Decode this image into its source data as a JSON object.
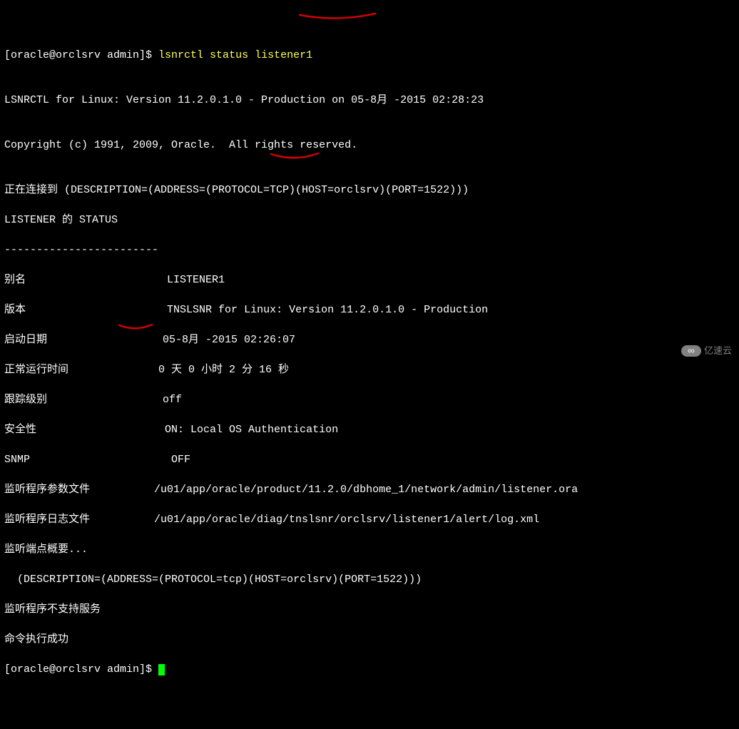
{
  "prompt1_prefix": "[oracle@orclsrv admin]$ ",
  "prompt1_cmd": "lsnrctl status listener1",
  "blank": "",
  "banner": "LSNRCTL for Linux: Version 11.2.0.1.0 - Production on 05-8月 -2015 02:28:23",
  "copyright": "Copyright (c) 1991, 2009, Oracle.  All rights reserved.",
  "connecting": "正在连接到 (DESCRIPTION=(ADDRESS=(PROTOCOL=TCP)(HOST=orclsrv)(PORT=1522)))",
  "status_header": "LISTENER 的 STATUS",
  "dashes": "------------------------",
  "alias_label": "别名                      ",
  "alias_value": "LISTENER1",
  "version_label": "版本                      ",
  "version_value": "TNSLSNR for Linux: Version 11.2.0.1.0 - Production",
  "startdate_label": "启动日期                  ",
  "startdate_value": "05-8月 -2015 02:26:07",
  "uptime_label": "正常运行时间              ",
  "uptime_value": "0 天 0 小时 2 分 16 秒",
  "trace_label": "跟踪级别                  ",
  "trace_value": "off",
  "security_label": "安全性                    ",
  "security_value": "ON: Local OS Authentication",
  "snmp_label": "SNMP                      ",
  "snmp_value": "OFF",
  "paramfile_label": "监听程序参数文件          ",
  "paramfile_value": "/u01/app/oracle/product/11.2.0/dbhome_1/network/admin/listener.ora",
  "logfile_label": "监听程序日志文件          ",
  "logfile_value": "/u01/app/oracle/diag/tnslsnr/orclsrv/listener1/alert/log.xml",
  "endpoints_summary": "监听端点概要...",
  "endpoint_desc": "  (DESCRIPTION=(ADDRESS=(PROTOCOL=tcp)(HOST=orclsrv)(PORT=1522)))",
  "no_services": "监听程序不支持服务",
  "cmd_success": "命令执行成功",
  "prompt2": "[oracle@orclsrv admin]$ ",
  "watermark_text": "亿速云"
}
